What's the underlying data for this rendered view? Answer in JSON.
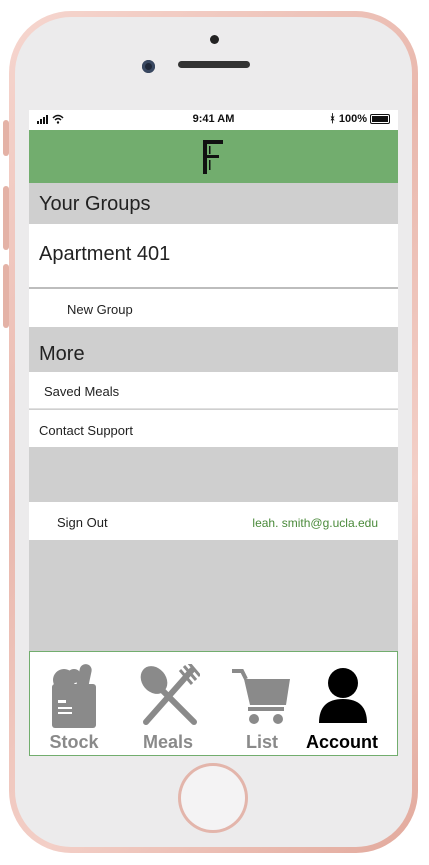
{
  "status_bar": {
    "time": "9:41 AM",
    "battery": "100%"
  },
  "header": {
    "logo": "F"
  },
  "groups": {
    "title": "Your Groups",
    "items": [
      "Apartment 401"
    ],
    "new_group": "New Group"
  },
  "more": {
    "title": "More",
    "saved_meals": "Saved Meals",
    "contact_support": "Contact Support"
  },
  "account": {
    "sign_out": "Sign Out",
    "email": "leah. smith@g.ucla.edu"
  },
  "tabs": [
    {
      "label": "Stock",
      "icon": "grocery-bag-icon",
      "active": false
    },
    {
      "label": "Meals",
      "icon": "fork-spoon-icon",
      "active": false
    },
    {
      "label": "List",
      "icon": "cart-icon",
      "active": false
    },
    {
      "label": "Account",
      "icon": "user-icon",
      "active": true
    }
  ],
  "colors": {
    "accent": "#72ad6e",
    "inactive": "#8a8a8a",
    "active": "#000000",
    "email": "#4a8a3a"
  }
}
